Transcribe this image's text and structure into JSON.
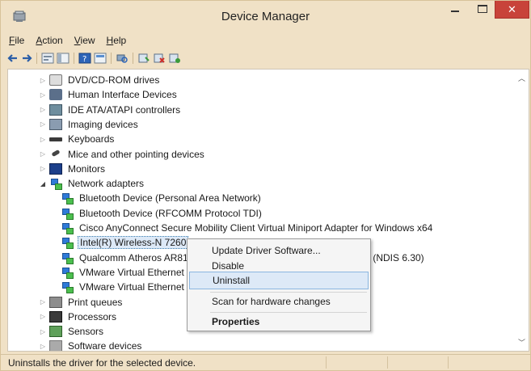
{
  "window": {
    "title": "Device Manager",
    "close_glyph": "✕"
  },
  "menu": [
    {
      "label": "File",
      "key": "F",
      "rest": "ile"
    },
    {
      "label": "Action",
      "key": "A",
      "rest": "ction"
    },
    {
      "label": "View",
      "key": "V",
      "rest": "iew"
    },
    {
      "label": "Help",
      "key": "H",
      "rest": "elp"
    }
  ],
  "toolbar": [
    "back-arrow-icon",
    "forward-arrow-icon",
    "properties-icon",
    "console-tree-icon",
    "help-icon",
    "show-hidden-icon",
    "scan-hardware-icon",
    "update-driver-icon",
    "uninstall-icon",
    "enable-device-icon"
  ],
  "tree": {
    "items": [
      {
        "label": "DVD/CD-ROM drives",
        "icon": "dvd-drive-icon",
        "level": 0,
        "expander": "▷"
      },
      {
        "label": "Human Interface Devices",
        "icon": "hid-icon",
        "level": 0,
        "expander": "▷"
      },
      {
        "label": "IDE ATA/ATAPI controllers",
        "icon": "ide-controller-icon",
        "level": 0,
        "expander": "▷"
      },
      {
        "label": "Imaging devices",
        "icon": "camera-icon",
        "level": 0,
        "expander": "▷"
      },
      {
        "label": "Keyboards",
        "icon": "keyboard-icon",
        "level": 0,
        "expander": "▷"
      },
      {
        "label": "Mice and other pointing devices",
        "icon": "mouse-icon",
        "level": 0,
        "expander": "▷"
      },
      {
        "label": "Monitors",
        "icon": "monitor-icon",
        "level": 0,
        "expander": "▷"
      },
      {
        "label": "Network adapters",
        "icon": "network-adapter-icon",
        "level": 0,
        "expander": "◢"
      },
      {
        "label": "Bluetooth Device (Personal Area Network)",
        "icon": "network-adapter-icon",
        "level": 1,
        "expander": ""
      },
      {
        "label": "Bluetooth Device (RFCOMM Protocol TDI)",
        "icon": "network-adapter-icon",
        "level": 1,
        "expander": ""
      },
      {
        "label": "Cisco AnyConnect Secure Mobility Client Virtual Miniport Adapter for Windows x64",
        "icon": "network-adapter-icon",
        "level": 1,
        "expander": ""
      },
      {
        "label": "Intel(R) Wireless-N 7260",
        "icon": "network-adapter-icon",
        "level": 1,
        "expander": "",
        "selected": true
      },
      {
        "label": "Qualcomm Atheros AR81",
        "tail": "r (NDIS 6.30)",
        "icon": "network-adapter-icon",
        "level": 1,
        "expander": ""
      },
      {
        "label": "VMware Virtual Ethernet",
        "icon": "network-adapter-icon",
        "level": 1,
        "expander": ""
      },
      {
        "label": "VMware Virtual Ethernet",
        "icon": "network-adapter-icon",
        "level": 1,
        "expander": ""
      },
      {
        "label": "Print queues",
        "icon": "printer-icon",
        "level": 0,
        "expander": "▷"
      },
      {
        "label": "Processors",
        "icon": "processor-icon",
        "level": 0,
        "expander": "▷"
      },
      {
        "label": "Sensors",
        "icon": "sensor-icon",
        "level": 0,
        "expander": "▷"
      },
      {
        "label": "Software devices",
        "icon": "software-device-icon",
        "level": 0,
        "expander": "▷"
      }
    ]
  },
  "context_menu": {
    "update": "Update Driver Software...",
    "disable": "Disable",
    "uninstall": "Uninstall",
    "scan": "Scan for hardware changes",
    "properties": "Properties"
  },
  "status": {
    "text": "Uninstalls the driver for the selected device."
  },
  "colors": {
    "title_bg": "#f0e1c6",
    "close_btn": "#c8433a",
    "highlight": "#dde9f7"
  }
}
